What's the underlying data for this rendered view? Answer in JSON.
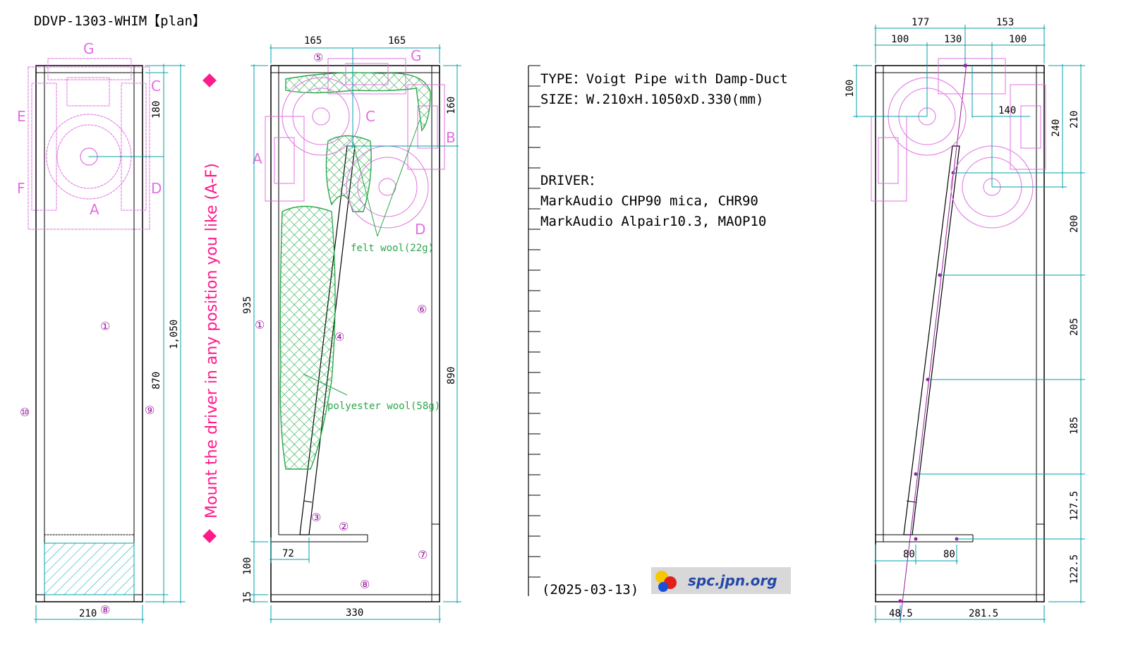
{
  "title": "DDVP-1303-WHIM【plan】",
  "side_text": "Mount the driver in any position you like (A-F)",
  "colors": {
    "frame": "#000000",
    "dimension": "#00a0a8",
    "driver": "#e070e0",
    "wool": "#2aa84a",
    "accent": "#ff1a8c",
    "note_dot": "#9a1aa0"
  },
  "view1": {
    "dims": {
      "width": "210",
      "height": "1,050",
      "inner": "870",
      "top": "180"
    },
    "labels": {
      "a": "A",
      "c": "C",
      "d": "D",
      "e": "E",
      "f": "F",
      "g": "G"
    },
    "parts": {
      "p1": "①",
      "p8": "⑧",
      "p9": "⑨",
      "p10": "⑩"
    }
  },
  "view2": {
    "dims": {
      "w_left": "165",
      "w_right": "165",
      "h_left": "935",
      "h_right": "890",
      "top_right": "160",
      "depth": "330",
      "bottom_a": "72",
      "bottom_b": "100",
      "bottom_c": "15"
    },
    "labels": {
      "a": "A",
      "b": "B",
      "c": "C",
      "d": "D",
      "g": "G"
    },
    "parts": {
      "p1": "①",
      "p2": "②",
      "p3": "③",
      "p4": "④",
      "p5": "⑤",
      "p6": "⑥",
      "p7": "⑦",
      "p8": "⑧"
    },
    "felt": "felt wool(22g)",
    "poly": "polyester wool(58g)"
  },
  "spec": {
    "type": "TYPE：Voigt Pipe with Damp-Duct",
    "size": "SIZE：W.210xH.1050xD.330(mm)",
    "driver": "DRIVER：",
    "d1": "MarkAudio CHP90 mica, CHR90",
    "d2": "MarkAudio Alpair10.3, MAOP10",
    "date": "(2025-03-13)",
    "logo": "spc.jpn.org"
  },
  "view3": {
    "dims": {
      "t1": "177",
      "t2": "153",
      "u1": "100",
      "u2": "130",
      "u3": "100",
      "left": "100",
      "mid": "140",
      "r240": "240",
      "r210": "210",
      "r200": "200",
      "r205": "205",
      "r185": "185",
      "r127": "127.5",
      "r122": "122.5",
      "b80a": "80",
      "b80b": "80",
      "b48": "48.5",
      "b281": "281.5"
    }
  }
}
